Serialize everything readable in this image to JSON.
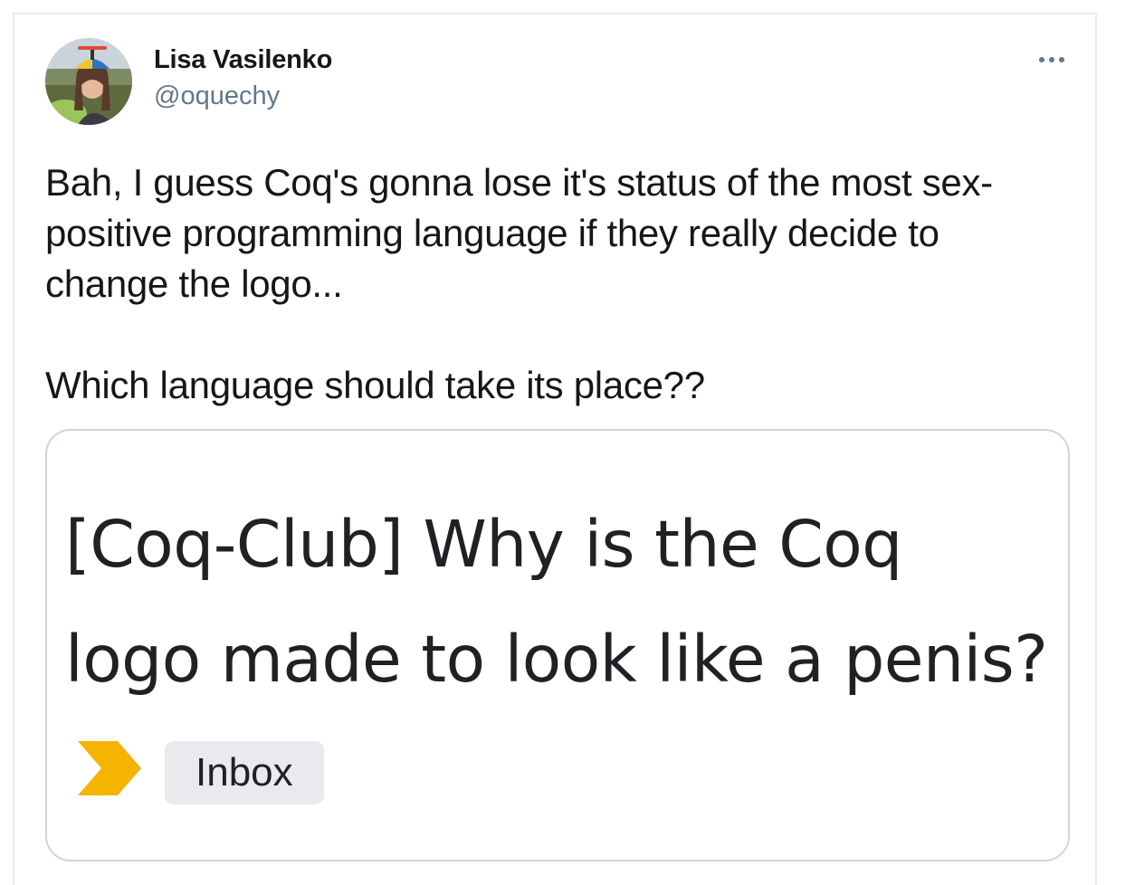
{
  "tweet": {
    "author": {
      "name": "Lisa Vasilenko",
      "handle": "@oquechy"
    },
    "text_line1": "Bah, I guess Coq's gonna lose it's status of the most sex-",
    "text_line2": "positive programming language if they really decide to",
    "text_line3": "change the logo...",
    "text_line4": "Which language should take its place??",
    "more_icon": "more-horizontal-icon"
  },
  "media": {
    "email_subject": "[Coq-Club] Why is the Coq logo made to look like a penis?",
    "importance_marker_color": "#f4b400",
    "label": "Inbox"
  }
}
